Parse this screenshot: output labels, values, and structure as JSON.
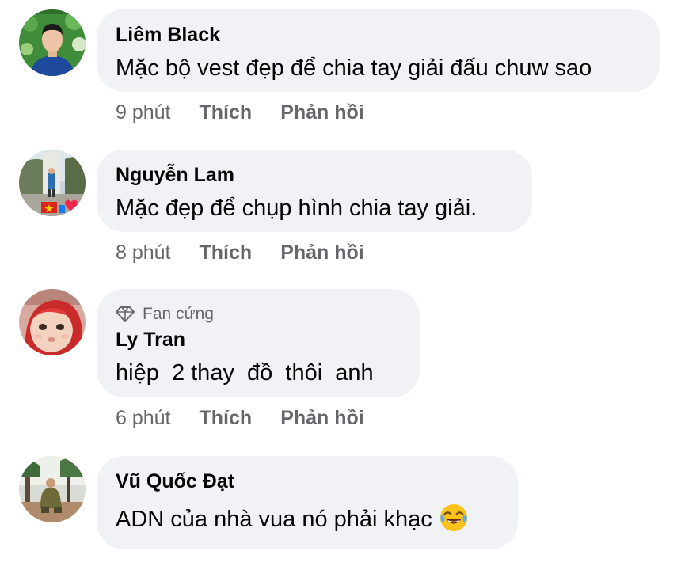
{
  "comments": [
    {
      "author": "Liêm Black",
      "text": "Mặc bộ vest đẹp để chia tay giải đấu chuw sao",
      "time": "9 phút",
      "like": "Thích",
      "reply": "Phản hồi",
      "avatar_icon": "avatar-man-blue-shirt"
    },
    {
      "author": "Nguyễn Lam",
      "text": "Mặc đẹp để chụp hình chia tay giải.",
      "time": "8 phút",
      "like": "Thích",
      "reply": "Phản hồi",
      "avatar_icon": "avatar-monument"
    },
    {
      "badge": "Fan cứng",
      "author": "Ly Tran",
      "text": "hiệp  2 thay  đồ  thôi  anh",
      "time": "6 phút",
      "like": "Thích",
      "reply": "Phản hồi",
      "avatar_icon": "avatar-baby-red-hood"
    },
    {
      "author": "Vũ Quốc Đạt",
      "text": "ADN của nhà vua nó phải khạc",
      "emoji": "laughing-tears-emoji",
      "avatar_icon": "avatar-man-sitting-outdoors"
    }
  ],
  "colors": {
    "bubble": "#f0f2f5",
    "secondary_text": "#65676b",
    "primary_text": "#050505"
  }
}
